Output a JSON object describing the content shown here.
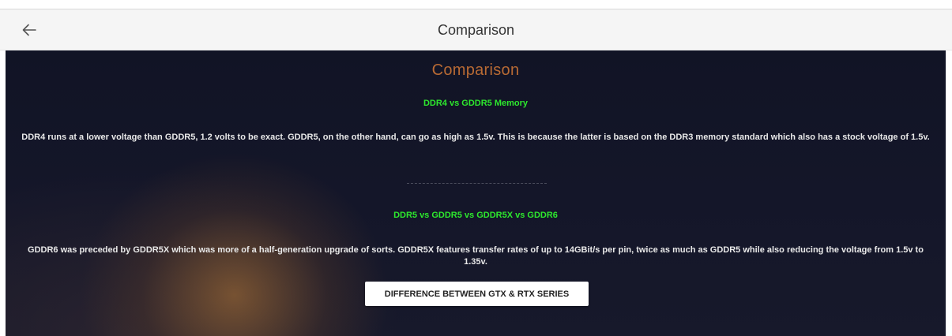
{
  "appbar": {
    "title": "Comparison",
    "back_icon": "arrow-left-icon"
  },
  "main": {
    "heading": "Comparison",
    "sections": [
      {
        "title": "DDR4 vs GDDR5 Memory",
        "body": "DDR4 runs at a lower voltage than GDDR5, 1.2 volts to be exact. GDDR5, on the other hand, can go as high as 1.5v. This is because the latter is based on the DDR3 memory standard which also has a stock voltage of 1.5v."
      },
      {
        "title": "DDR5 vs GDDR5 vs GDDR5X vs GDDR6",
        "body": "GDDR6 was preceded by GDDR5X which was more of a half-generation upgrade of sorts. GDDR5X features transfer rates of up to 14GBit/s per pin, twice as much as GDDR5 while also reducing the voltage from 1.5v to 1.35v."
      }
    ],
    "cta_label": "DIFFERENCE BETWEEN GTX & RTX SERIES"
  },
  "colors": {
    "heading": "#b86a34",
    "subhead": "#2de82d",
    "body_text": "#e9e9e9",
    "background": "#141629"
  }
}
